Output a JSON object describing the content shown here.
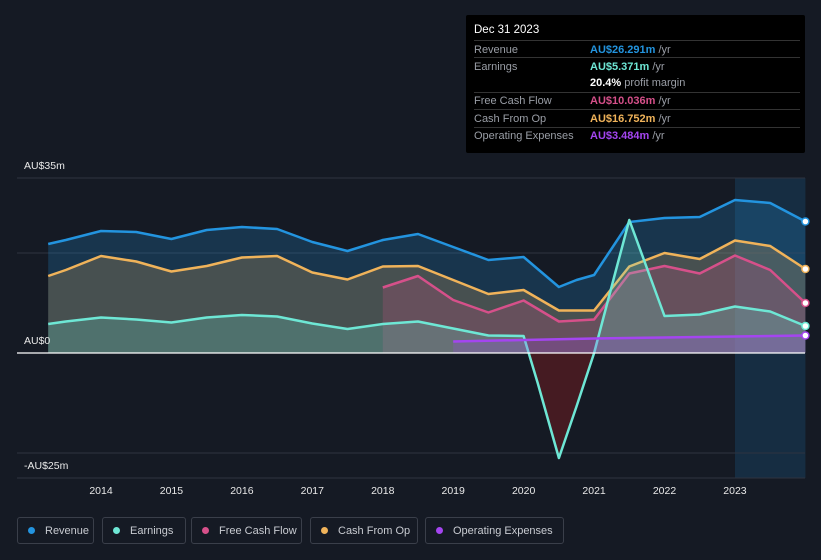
{
  "tooltip": {
    "date": "Dec 31 2023",
    "rows": [
      {
        "label": "Revenue",
        "value": "AU$26.291m",
        "unit": "/yr",
        "color": "#2394df"
      },
      {
        "label": "Earnings",
        "value": "AU$5.371m",
        "unit": "/yr",
        "color": "#6ee7d5"
      },
      {
        "label": "",
        "value": "20.4%",
        "unit": "profit margin",
        "color": "#ffffff"
      },
      {
        "label": "Free Cash Flow",
        "value": "AU$10.036m",
        "unit": "/yr",
        "color": "#d6508a"
      },
      {
        "label": "Cash From Op",
        "value": "AU$16.752m",
        "unit": "/yr",
        "color": "#f0b35a"
      },
      {
        "label": "Operating Expenses",
        "value": "AU$3.484m",
        "unit": "/yr",
        "color": "#a445f0"
      }
    ]
  },
  "chart_data": {
    "type": "area",
    "y_tick_labels": [
      "AU$35m",
      "AU$0",
      "-AU$25m"
    ],
    "x_tick_labels": [
      "2014",
      "2015",
      "2016",
      "2017",
      "2018",
      "2019",
      "2020",
      "2021",
      "2022",
      "2023"
    ],
    "ylim": [
      -25,
      35
    ],
    "xlim": [
      2013.25,
      2024.0
    ],
    "gridlines_y": [
      35,
      20,
      0,
      -20
    ],
    "highlight_from": 2023.0,
    "legend_position": "bottom",
    "x": [
      2013.25,
      2013.5,
      2014,
      2014.5,
      2015,
      2015.5,
      2016,
      2016.5,
      2017,
      2017.5,
      2018,
      2018.5,
      2019,
      2019.5,
      2020,
      2020.5,
      2020.75,
      2021,
      2021.5,
      2022,
      2022.5,
      2023,
      2023.5,
      2024
    ],
    "series": [
      {
        "name": "Revenue",
        "color": "#2394df",
        "values": [
          21.8,
          22.6,
          24.4,
          24.2,
          22.8,
          24.6,
          25.2,
          24.8,
          22.2,
          20.4,
          22.6,
          23.8,
          21.2,
          18.6,
          19.2,
          13.2,
          14.6,
          15.6,
          26.2,
          27.0,
          27.2,
          30.6,
          30.0,
          26.3
        ]
      },
      {
        "name": "Cash From Op",
        "color": "#f0b35a",
        "values": [
          15.4,
          16.6,
          19.4,
          18.3,
          16.3,
          17.4,
          19.1,
          19.4,
          16.1,
          14.7,
          17.3,
          17.4,
          14.6,
          11.8,
          12.6,
          8.5,
          8.5,
          8.5,
          17.3,
          20.0,
          18.8,
          22.5,
          21.4,
          16.8
        ]
      },
      {
        "name": "Free Cash Flow",
        "color": "#d6508a",
        "x": [
          2018,
          2018.5,
          2019,
          2019.5,
          2020,
          2020.5,
          2020.75,
          2021,
          2021.5,
          2022,
          2022.5,
          2023,
          2023.5,
          2024
        ],
        "values": [
          13.1,
          15.4,
          10.6,
          8.1,
          10.5,
          6.3,
          6.5,
          6.7,
          15.9,
          17.4,
          15.9,
          19.5,
          16.6,
          10.0
        ]
      },
      {
        "name": "Earnings",
        "color": "#6ee7d5",
        "x": [
          2013.25,
          2013.5,
          2014,
          2014.5,
          2015,
          2015.5,
          2016,
          2016.5,
          2017,
          2017.5,
          2018,
          2018.5,
          2019,
          2019.5,
          2020,
          2020.2,
          2020.5,
          2020.75,
          2021,
          2021.3,
          2021.5,
          2021.75,
          2022,
          2022.5,
          2023,
          2023.5,
          2024
        ],
        "values": [
          5.8,
          6.3,
          7.1,
          6.7,
          6.1,
          7.1,
          7.6,
          7.3,
          5.9,
          4.8,
          5.8,
          6.3,
          4.9,
          3.5,
          3.4,
          -6,
          -21,
          -10.7,
          0,
          16,
          26.6,
          17,
          7.4,
          7.7,
          9.3,
          8.3,
          5.4
        ]
      },
      {
        "name": "Operating Expenses",
        "color": "#a445f0",
        "x": [
          2019,
          2020,
          2021,
          2022,
          2023,
          2024
        ],
        "values": [
          2.3,
          2.6,
          2.9,
          3.1,
          3.3,
          3.5
        ]
      }
    ]
  }
}
